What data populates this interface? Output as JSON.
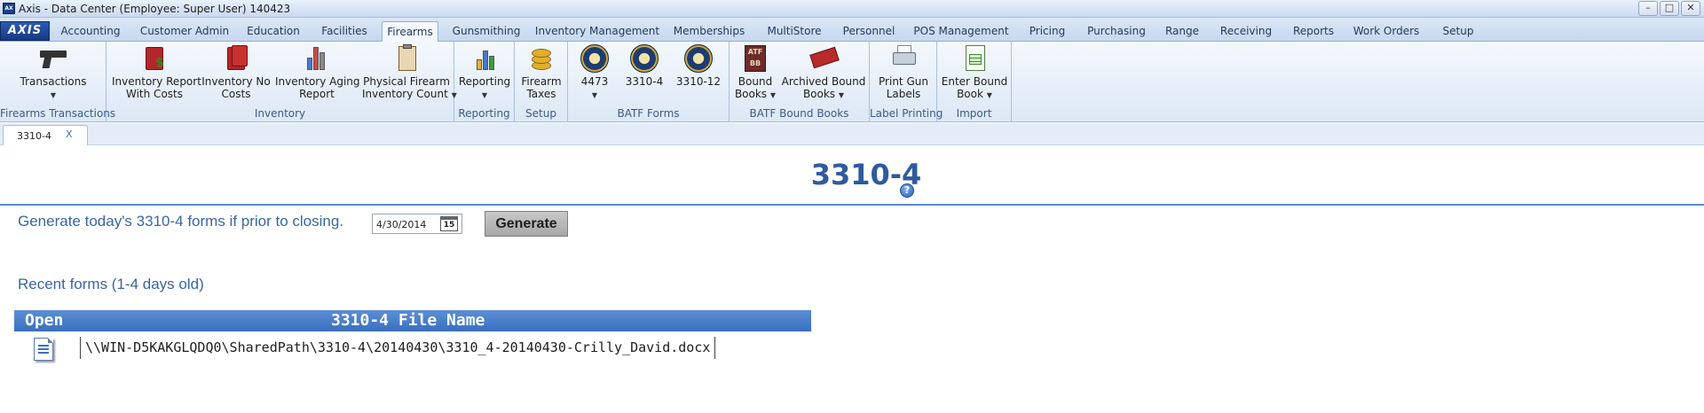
{
  "window": {
    "title": "Axis - Data Center  (Employee: Super User) 140423",
    "controls": [
      "–",
      "□",
      "✕"
    ]
  },
  "menu": {
    "logo": "AXIS",
    "tabs": [
      "Accounting",
      "Customer Admin",
      "Education",
      "Facilities",
      "Firearms",
      "Gunsmithing",
      "Inventory Management",
      "Memberships",
      "MultiStore",
      "Personnel",
      "POS Management",
      "Pricing",
      "Purchasing",
      "Range",
      "Receiving",
      "Reports",
      "Work Orders",
      "Setup"
    ],
    "active_tab": "Firearms"
  },
  "ribbon": {
    "groups": {
      "firearms_transactions": "Firearms Transactions",
      "inventory": "Inventory",
      "reporting": "Reporting",
      "setup": "Setup",
      "batf_forms": "BATF Forms",
      "batf_bound_books": "BATF Bound Books",
      "label_printing": "Label Printing",
      "import": "Import"
    },
    "buttons": {
      "transactions": "Transactions",
      "inv_report_costs_1": "Inventory Report",
      "inv_report_costs_2": "With Costs",
      "inv_no_costs_1": "Inventory No",
      "inv_no_costs_2": "Costs",
      "inv_aging_1": "Inventory Aging",
      "inv_aging_2": "Report",
      "physical_1": "Physical Firearm",
      "physical_2": "Inventory Count",
      "reporting": "Reporting",
      "firearm_taxes_1": "Firearm",
      "firearm_taxes_2": "Taxes",
      "form_4473": "4473",
      "form_3310_4": "3310-4",
      "form_3310_12": "3310-12",
      "bound_books_1": "Bound",
      "bound_books_2": "Books",
      "archived_1": "Archived Bound",
      "archived_2": "Books",
      "print_gun_1": "Print Gun",
      "print_gun_2": "Labels",
      "enter_bound_1": "Enter Bound",
      "enter_bound_2": "Book"
    },
    "icons": {
      "atf": "ATF BB"
    }
  },
  "doc_tab": {
    "label": "3310-4",
    "close": "X"
  },
  "main": {
    "title": "3310-4",
    "help": "?",
    "generate_text": "Generate today's 3310-4 forms if prior to closing.",
    "date_value": "4/30/2014",
    "calendar_day": "15",
    "generate_button": "Generate",
    "recent_text": "Recent forms (1-4 days old)",
    "grid": {
      "columns": [
        "Open",
        "3310-4 File Name"
      ],
      "rows": [
        {
          "file_name": "\\\\WIN-D5KAKGLQDQ0\\SharedPath\\3310-4\\20140430\\3310_4-20140430-Crilly_David.docx"
        }
      ]
    }
  },
  "colors": {
    "accent_blue": "#2f5a9e",
    "grid_header": "#3a6fbf",
    "ribbon_bg": "#dce8f6"
  }
}
